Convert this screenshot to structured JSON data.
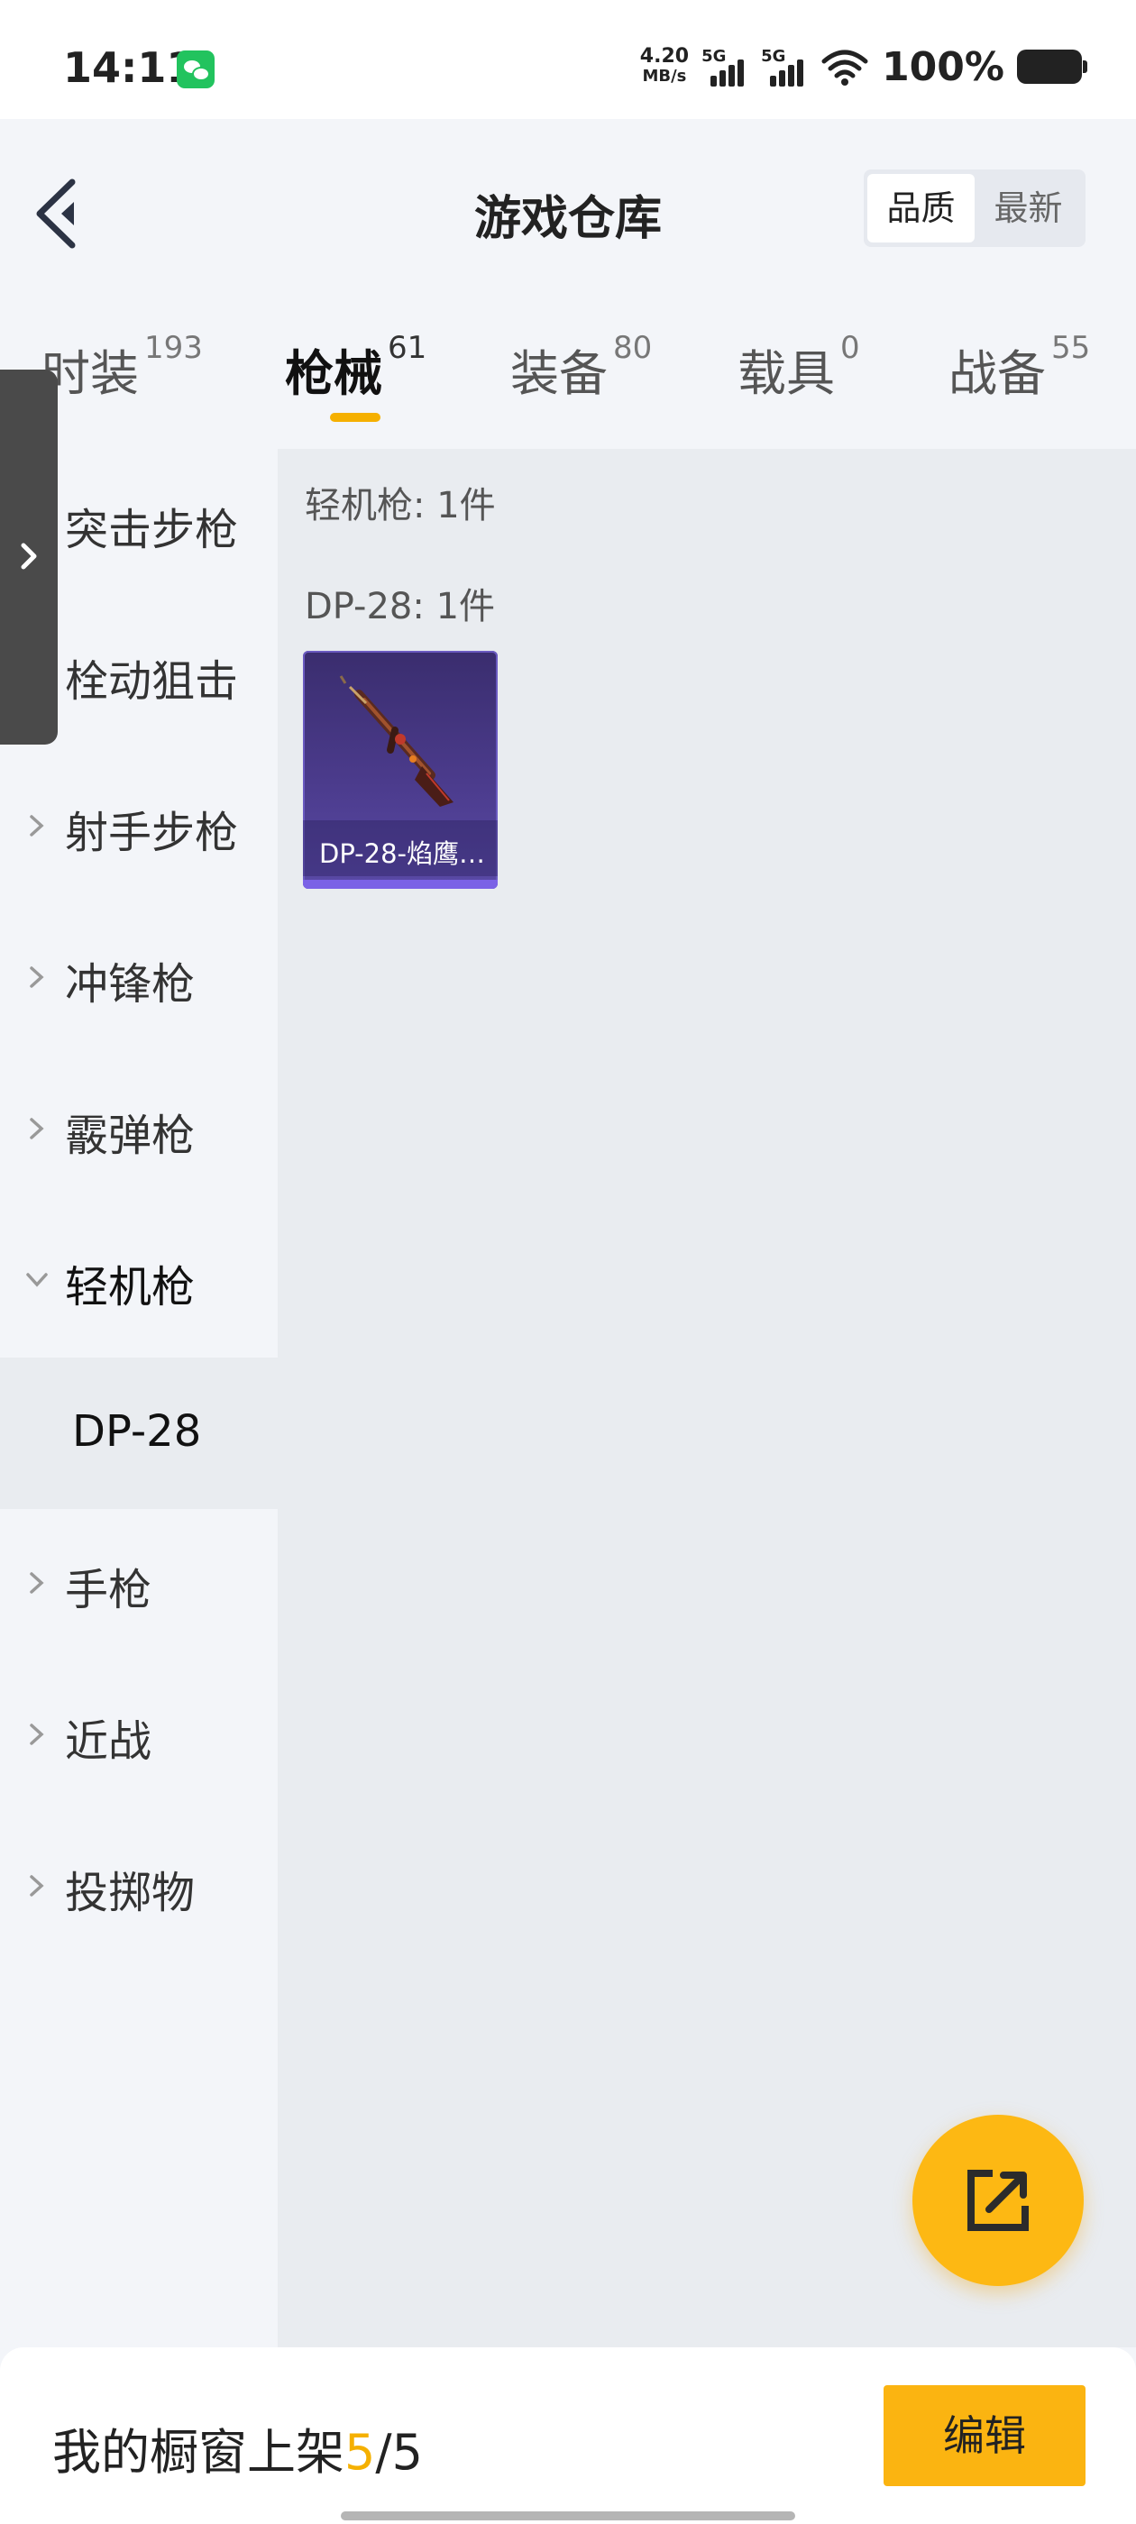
{
  "status_bar": {
    "time": "14:11",
    "net_speed_value": "4.20",
    "net_speed_unit": "MB/s",
    "signal_1": "5G",
    "signal_2": "5G",
    "battery": "100%",
    "app_icon": "wechat-icon"
  },
  "header": {
    "title": "游戏仓库",
    "back_icon": "chevron-left-icon",
    "sort_options": [
      "品质",
      "最新"
    ],
    "sort_selected": "品质"
  },
  "tabs": [
    {
      "label": "时装",
      "count": "193"
    },
    {
      "label": "枪械",
      "count": "61",
      "active": true
    },
    {
      "label": "装备",
      "count": "80"
    },
    {
      "label": "载具",
      "count": "0"
    },
    {
      "label": "战备",
      "count": "55"
    }
  ],
  "sidebar": {
    "categories": [
      "突击步枪",
      "栓动狙击",
      "射手步枪",
      "冲锋枪",
      "霰弹枪",
      "轻机枪",
      "手枪",
      "近战",
      "投掷物"
    ],
    "expanded": "轻机枪",
    "subcategory": "DP-28"
  },
  "content": {
    "group_label": "轻机枪: 1件",
    "sub_label": "DP-28: 1件",
    "items": [
      {
        "name": "DP-28-焰鹰…",
        "rarity_color": "#7b62e6"
      }
    ]
  },
  "fab": {
    "icon": "share-external-icon"
  },
  "bottom_bar": {
    "shelf_label": "我的橱窗上架",
    "shelf_current": "5",
    "shelf_sep": "/",
    "shelf_total": "5",
    "edit_label": "编辑"
  },
  "colors": {
    "accent": "#f5b000",
    "button": "#fbb411",
    "item_bg": "#4b3b8c"
  }
}
